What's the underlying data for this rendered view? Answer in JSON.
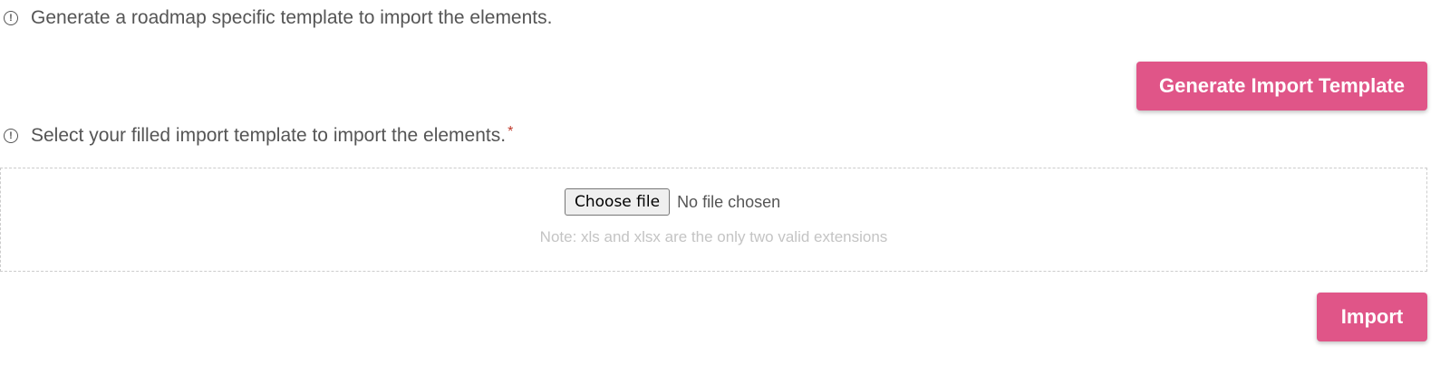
{
  "generate_section": {
    "info_text": "Generate a roadmap specific template to import the elements.",
    "button_label": "Generate Import Template"
  },
  "import_section": {
    "info_text": "Select your filled import template to import the elements.",
    "required_mark": "*",
    "file_input": {
      "button_label": "Choose file",
      "status_text": "No file chosen"
    },
    "note": "Note: xls and xlsx are the only two valid extensions",
    "button_label": "Import"
  },
  "icons": {
    "info": "info-circle-icon"
  },
  "colors": {
    "primary_button": "#e05588",
    "text": "#555555",
    "note_text": "#c4c4c4",
    "required": "#c0392b"
  }
}
